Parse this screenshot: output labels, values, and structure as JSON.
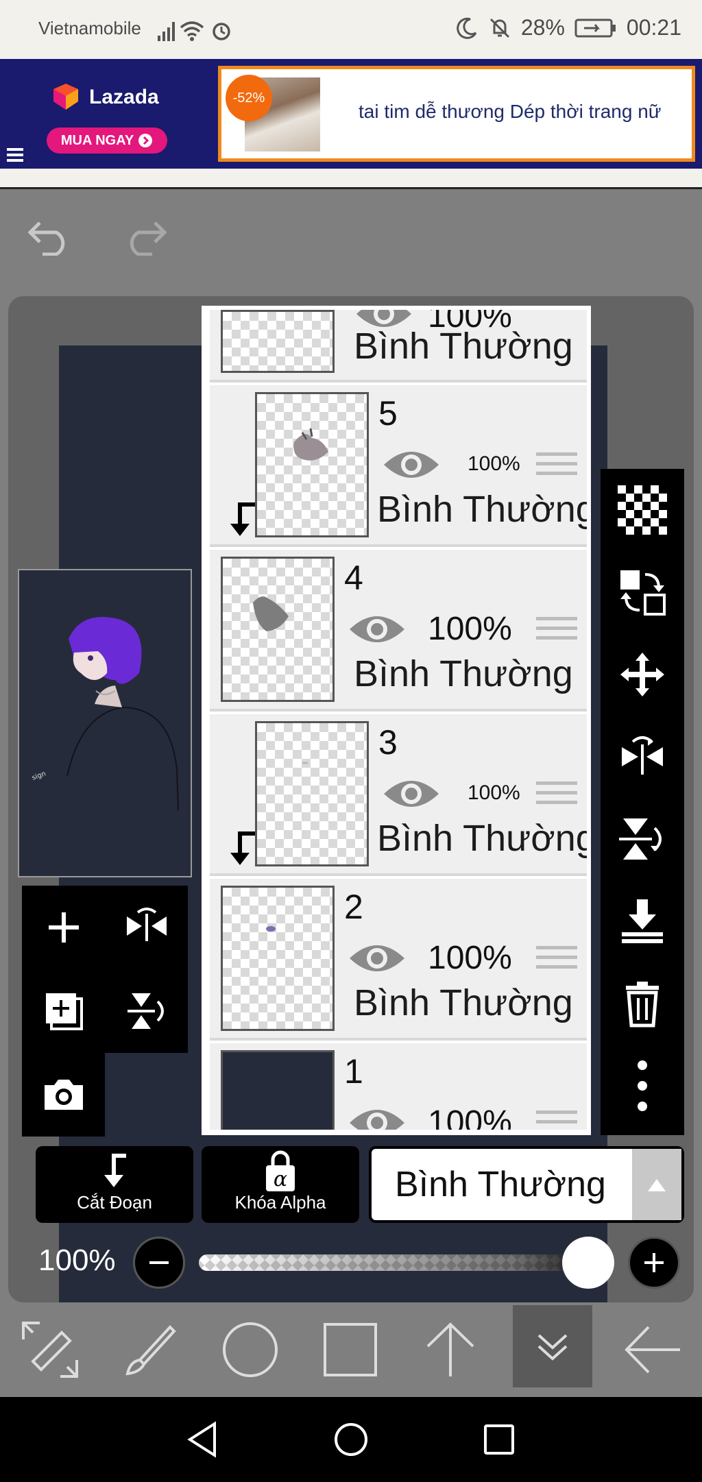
{
  "status_bar": {
    "carrier": "Vietnamobile",
    "battery": "28%",
    "time": "00:21",
    "icons": [
      "signal-icon",
      "wifi-icon",
      "alarm-icon",
      "moon-icon",
      "mute-icon",
      "battery-charging-icon"
    ]
  },
  "ad": {
    "brand": "Lazada",
    "cta": "MUA NGAY",
    "discount": "-52%",
    "text": "tai tim dễ thương Dép thời trang nữ",
    "colors": {
      "banner": "#1a1a6e",
      "cta": "#e3177c",
      "border": "#f08a1e"
    }
  },
  "toolbar": {
    "undo_icon": "undo-icon",
    "redo_icon": "redo-icon"
  },
  "layers": [
    {
      "number": "",
      "opacity": "100%",
      "mode": "Bình Thường",
      "clipped": false
    },
    {
      "number": "5",
      "opacity": "100%",
      "mode": "Bình Thường",
      "clipped": true
    },
    {
      "number": "4",
      "opacity": "100%",
      "mode": "Bình Thường",
      "clipped": false
    },
    {
      "number": "3",
      "opacity": "100%",
      "mode": "Bình Thường",
      "clipped": true
    },
    {
      "number": "2",
      "opacity": "100%",
      "mode": "Bình Thường",
      "clipped": false
    },
    {
      "number": "1",
      "opacity": "100%",
      "mode": "Bình Thường",
      "clipped": false
    }
  ],
  "actions": {
    "clipping_label": "Cắt Đoạn",
    "alpha_lock_label": "Khóa Alpha",
    "blend_mode": "Bình Thường"
  },
  "opacity": {
    "label": "100%",
    "value": 1.0
  },
  "bottom_tools": [
    "transform-tool-icon",
    "brush-icon",
    "circle-select-icon",
    "square-select-icon",
    "arrow-up-icon",
    "chevron-double-down-icon",
    "arrow-left-icon"
  ],
  "nav": [
    "back-icon",
    "home-icon",
    "recents-icon"
  ]
}
